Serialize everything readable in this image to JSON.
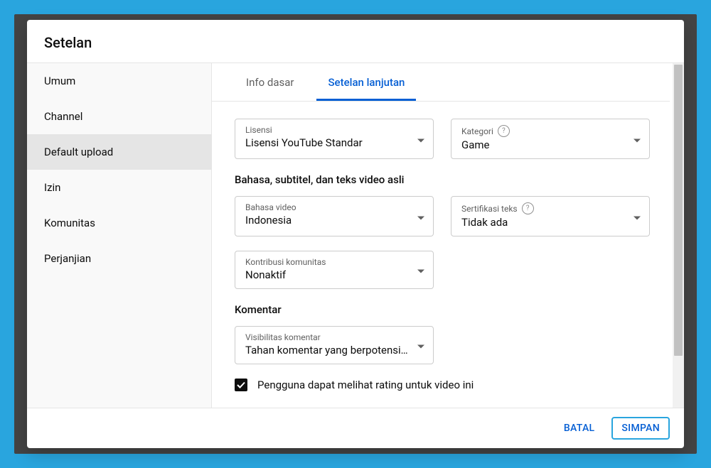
{
  "dialog": {
    "title": "Setelan"
  },
  "sidebar": {
    "items": [
      {
        "label": "Umum"
      },
      {
        "label": "Channel"
      },
      {
        "label": "Default upload"
      },
      {
        "label": "Izin"
      },
      {
        "label": "Komunitas"
      },
      {
        "label": "Perjanjian"
      }
    ],
    "selectedIndex": 2
  },
  "tabs": {
    "items": [
      {
        "label": "Info dasar"
      },
      {
        "label": "Setelan lanjutan"
      }
    ],
    "activeIndex": 1
  },
  "form": {
    "license": {
      "label": "Lisensi",
      "value": "Lisensi YouTube Standar"
    },
    "category": {
      "label": "Kategori",
      "value": "Game",
      "help": true
    },
    "section_language_title": "Bahasa, subtitel, dan teks video asli",
    "video_language": {
      "label": "Bahasa video",
      "value": "Indonesia"
    },
    "caption_cert": {
      "label": "Sertifikasi teks",
      "value": "Tidak ada",
      "help": true
    },
    "community_contrib": {
      "label": "Kontribusi komunitas",
      "value": "Nonaktif"
    },
    "section_comments_title": "Komentar",
    "comment_visibility": {
      "label": "Visibilitas komentar",
      "value": "Tahan komentar yang berpotensi..."
    },
    "ratings_checkbox": {
      "checked": true,
      "label": "Pengguna dapat melihat rating untuk video ini"
    }
  },
  "footer": {
    "cancel": "BATAL",
    "save": "SIMPAN"
  }
}
